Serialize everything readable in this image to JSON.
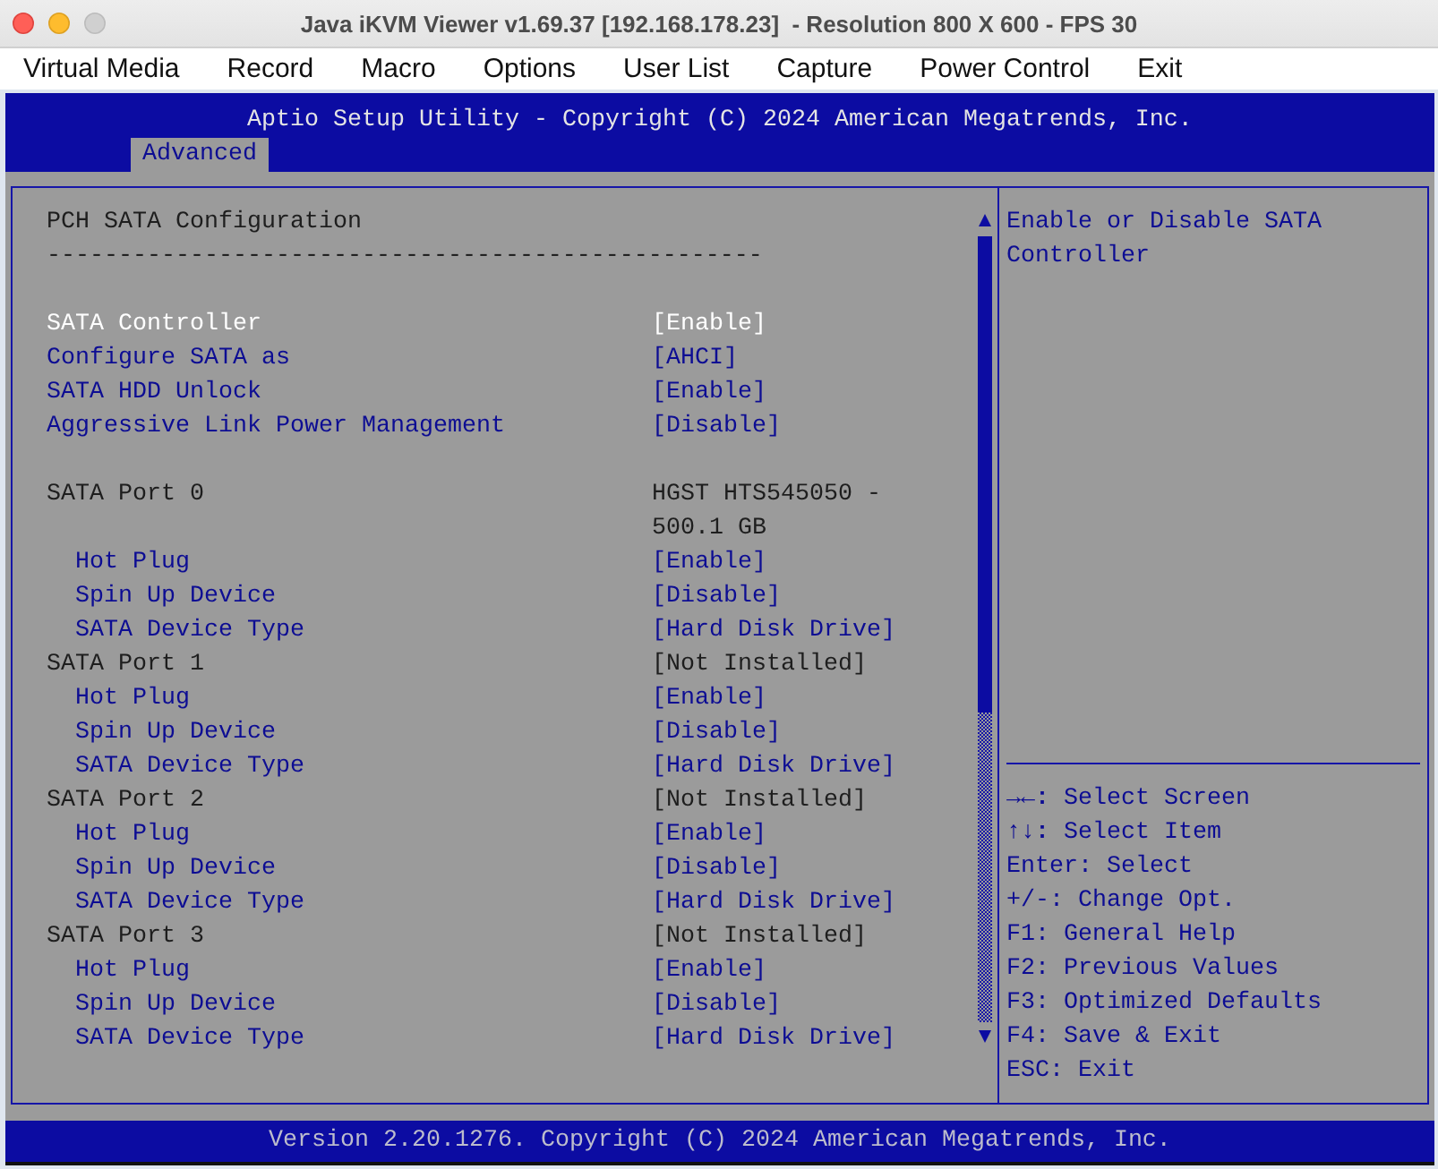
{
  "window": {
    "title": "Java iKVM Viewer v1.69.37 [192.168.178.23]  - Resolution 800 X 600 - FPS 30",
    "zoom_enabled": false
  },
  "menu": [
    "Virtual Media",
    "Record",
    "Macro",
    "Options",
    "User List",
    "Capture",
    "Power Control",
    "Exit"
  ],
  "bios": {
    "title": "Aptio Setup Utility - Copyright (C) 2024 American Megatrends, Inc.",
    "tabs": [
      {
        "label": "Advanced",
        "selected": true
      }
    ]
  },
  "main": {
    "title": "PCH SATA Configuration",
    "separator": "--------------------------------------------------",
    "groups": [
      {
        "items": [
          {
            "kind": "option",
            "label": "SATA Controller",
            "value": "[Enable]",
            "selected": true
          },
          {
            "kind": "option",
            "label": "Configure SATA as",
            "value": "[AHCI]",
            "selected": false
          },
          {
            "kind": "option",
            "label": "SATA HDD Unlock",
            "value": "[Enable]",
            "selected": false
          },
          {
            "kind": "option",
            "label": "Aggressive Link Power Management",
            "value": "[Disable]",
            "selected": false
          }
        ]
      },
      {
        "items": [
          {
            "kind": "info",
            "label": "SATA Port 0",
            "value": "HGST HTS545050 - 500.1 GB",
            "selected": false,
            "children": [
              {
                "kind": "option",
                "label": "Hot Plug",
                "value": "[Enable]",
                "selected": false
              },
              {
                "kind": "option",
                "label": "Spin Up Device",
                "value": "[Disable]",
                "selected": false
              },
              {
                "kind": "option",
                "label": "SATA Device Type",
                "value": "[Hard Disk Drive]",
                "selected": false
              }
            ]
          },
          {
            "kind": "info",
            "label": "SATA Port 1",
            "value": "[Not Installed]",
            "selected": false,
            "children": [
              {
                "kind": "option",
                "label": "Hot Plug",
                "value": "[Enable]",
                "selected": false
              },
              {
                "kind": "option",
                "label": "Spin Up Device",
                "value": "[Disable]",
                "selected": false
              },
              {
                "kind": "option",
                "label": "SATA Device Type",
                "value": "[Hard Disk Drive]",
                "selected": false
              }
            ]
          },
          {
            "kind": "info",
            "label": "SATA Port 2",
            "value": "[Not Installed]",
            "selected": false,
            "children": [
              {
                "kind": "option",
                "label": "Hot Plug",
                "value": "[Enable]",
                "selected": false
              },
              {
                "kind": "option",
                "label": "Spin Up Device",
                "value": "[Disable]",
                "selected": false
              },
              {
                "kind": "option",
                "label": "SATA Device Type",
                "value": "[Hard Disk Drive]",
                "selected": false
              }
            ]
          },
          {
            "kind": "info",
            "label": "SATA Port 3",
            "value": "[Not Installed]",
            "selected": false,
            "children": [
              {
                "kind": "option",
                "label": "Hot Plug",
                "value": "[Enable]",
                "selected": false
              },
              {
                "kind": "option",
                "label": "Spin Up Device",
                "value": "[Disable]",
                "selected": false
              },
              {
                "kind": "option",
                "label": "SATA Device Type",
                "value": "[Hard Disk Drive]",
                "selected": false
              }
            ]
          }
        ]
      }
    ]
  },
  "help": {
    "text": "Enable or Disable SATA Controller",
    "keys": [
      "**→←:** Select Screen",
      "**↑↓:** Select Item",
      "Enter: Select",
      "+/-: Change Opt.",
      "F1: General Help",
      "F2: Previous Values",
      "F3: Optimized Defaults",
      "F4: Save & Exit",
      "ESC: Exit"
    ]
  },
  "footer": "Version 2.20.1276. Copyright (C) 2024 American Megatrends, Inc."
}
